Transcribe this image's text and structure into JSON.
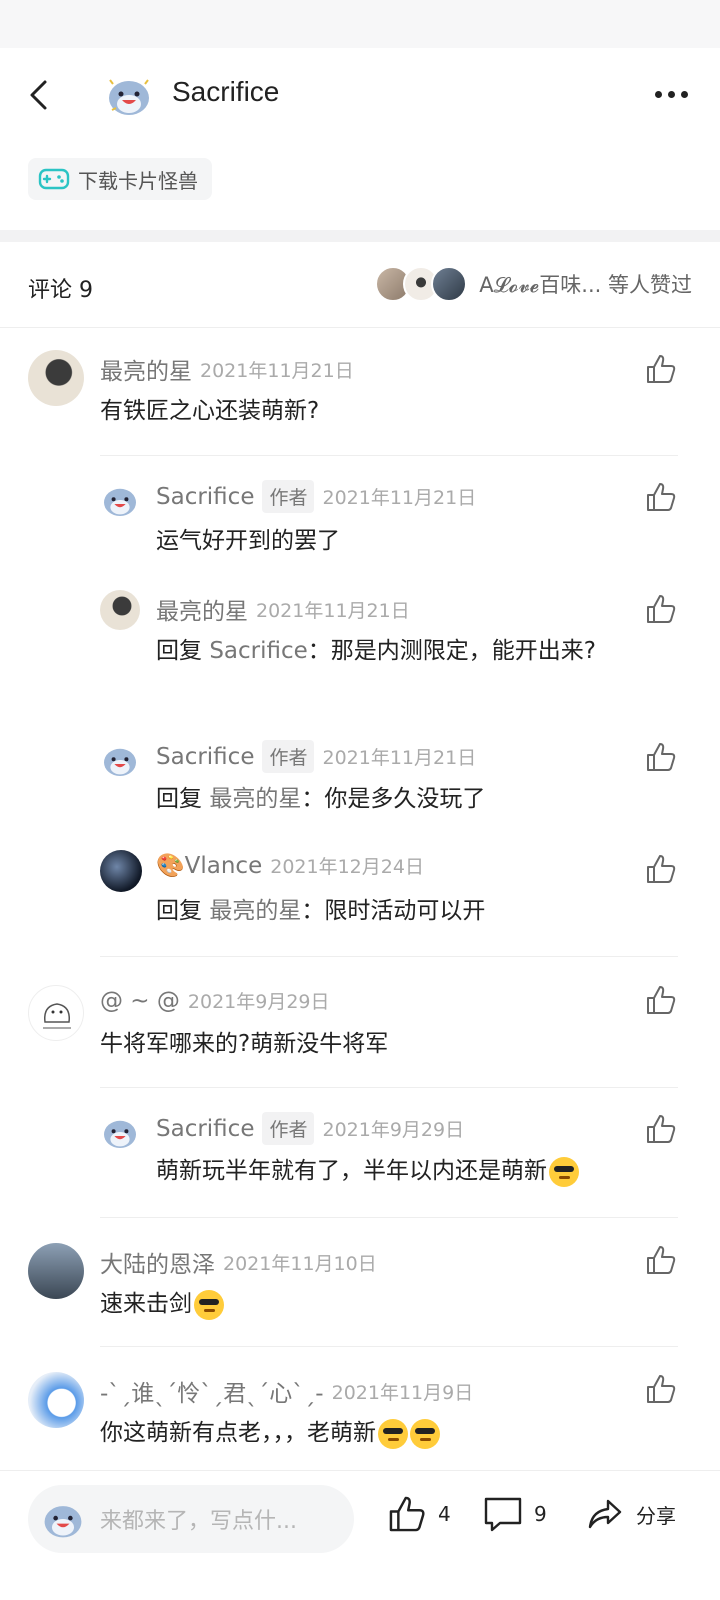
{
  "header": {
    "author_name": "Sacrifice",
    "back_icon": "chevron-left-icon",
    "more_icon": "more-dots-icon"
  },
  "game_chip": {
    "label": "下载卡片怪兽",
    "icon": "gamepad-icon"
  },
  "comments_header": {
    "title": "评论 9",
    "likers_text": "A𝓛𝓸𝓿𝓮百味... 等人赞过"
  },
  "comments": [
    {
      "user": "最亮的星",
      "date": "2021年11月21日",
      "text": "有铁匠之心还装萌新?",
      "replies": [
        {
          "user": "Sacrifice",
          "tag": "作者",
          "date": "2021年11月21日",
          "prefix": "",
          "mention": "",
          "text": "运气好开到的罢了"
        },
        {
          "user": "最亮的星",
          "tag": "",
          "date": "2021年11月21日",
          "prefix": "回复 ",
          "mention": "Sacrifice",
          "text": "：那是内测限定，能开出来?"
        },
        {
          "user": "Sacrifice",
          "tag": "作者",
          "date": "2021年11月21日",
          "prefix": "回复 ",
          "mention": "最亮的星",
          "text": "：你是多久没玩了"
        },
        {
          "user": "🎨Vlance",
          "tag": "",
          "date": "2021年12月24日",
          "prefix": "回复 ",
          "mention": "最亮的星",
          "text": "：限时活动可以开"
        }
      ]
    },
    {
      "user": "@ ~ @",
      "date": "2021年9月29日",
      "text": "牛将军哪来的?萌新没牛将军",
      "replies": [
        {
          "user": "Sacrifice",
          "tag": "作者",
          "date": "2021年9月29日",
          "prefix": "",
          "mention": "",
          "text": "萌新玩半年就有了，半年以内还是萌新"
        }
      ]
    },
    {
      "user": "大陆的恩泽",
      "date": "2021年11月10日",
      "text": "速来击剑",
      "replies": []
    },
    {
      "user": "-ˋˏ谁ˎˊ怜ˋˏ君ˎˊ心ˋˏ-",
      "date": "2021年11月9日",
      "text": "你这萌新有点老，，，老萌新",
      "replies": []
    }
  ],
  "bottom_bar": {
    "input_placeholder": "来都来了，写点什...",
    "like_count": "4",
    "comment_count": "9",
    "share_label": "分享"
  },
  "colors": {
    "accent_teal": "#2bc4c4",
    "text_primary": "#222222",
    "text_secondary": "#777777"
  }
}
